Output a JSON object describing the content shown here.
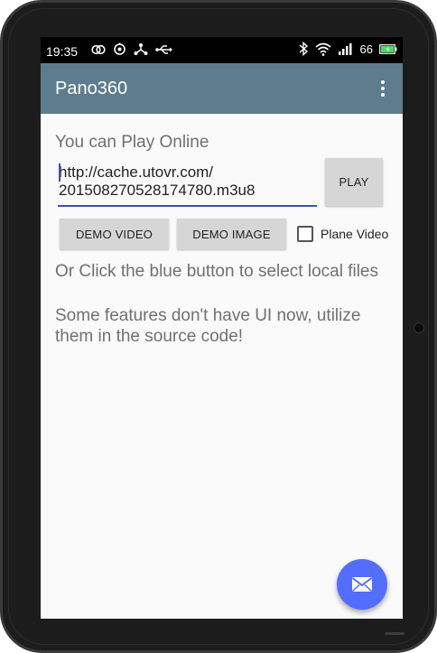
{
  "status_bar": {
    "time": "19:35",
    "battery_level": "66",
    "icons_left": [
      "group-icon",
      "sync-icon",
      "branch-icon",
      "usb-icon"
    ],
    "icons_right": [
      "bluetooth-icon",
      "wifi-icon",
      "signal-icon",
      "battery-icon"
    ]
  },
  "app_bar": {
    "title": "Pano360",
    "menu_icon": "more-vert-icon",
    "color": "#5e7d8c"
  },
  "main": {
    "online_hint": "You can Play Online",
    "url_value": "http://cache.utovr.com/\n201508270528174780.m3u8",
    "play_label": "PLAY",
    "demo_video_label": "DEMO VIDEO",
    "demo_image_label": "DEMO IMAGE",
    "plane_video_label": "Plane Video",
    "plane_video_checked": false,
    "local_hint": "Or Click the blue button to select local files",
    "source_hint": "Some features don't have UI now, utilize them in the source code!"
  },
  "fab": {
    "icon": "email-icon",
    "color": "#536dfe"
  }
}
